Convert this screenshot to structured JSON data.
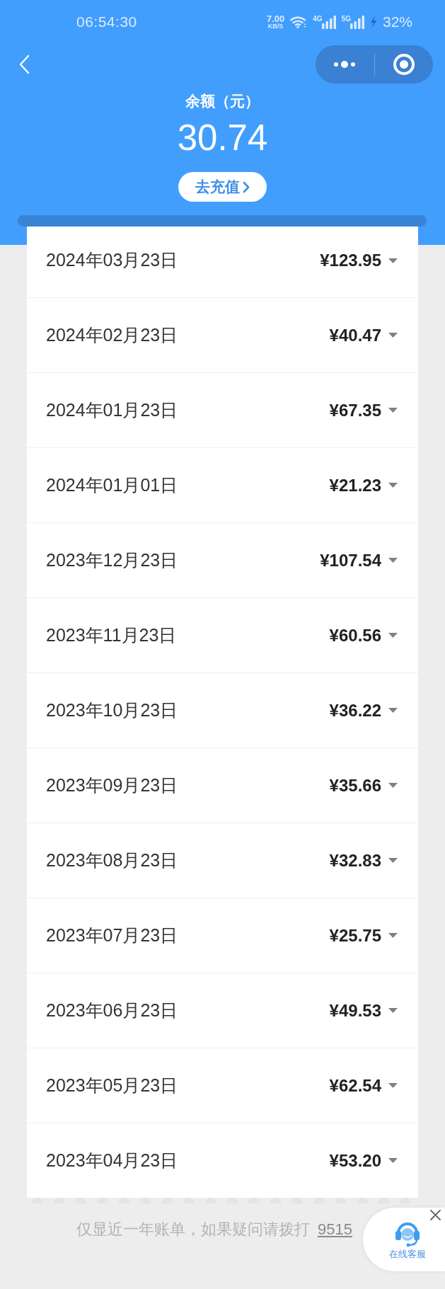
{
  "status_bar": {
    "time": "06:54:30",
    "network_speed": "7.00",
    "network_speed_unit": "KB/S",
    "signal_labels": [
      "4G",
      "5G"
    ],
    "battery": "32%"
  },
  "header": {
    "balance_label": "余额（元）",
    "balance": "30.74",
    "recharge_button": "去充值"
  },
  "bills": [
    {
      "date": "2024年03月23日",
      "amount": "¥123.95",
      "expanded": false
    },
    {
      "date": "2024年02月23日",
      "amount": "¥40.47",
      "expanded": false
    },
    {
      "date": "2024年01月23日",
      "amount": "¥67.35",
      "expanded": false
    },
    {
      "date": "2024年01月01日",
      "amount": "¥21.23",
      "expanded": false
    },
    {
      "date": "2023年12月23日",
      "amount": "¥107.54",
      "expanded": false
    },
    {
      "date": "2023年11月23日",
      "amount": "¥60.56",
      "expanded": false
    },
    {
      "date": "2023年10月23日",
      "amount": "¥36.22",
      "expanded": false
    },
    {
      "date": "2023年09月23日",
      "amount": "¥35.66",
      "expanded": false
    },
    {
      "date": "2023年08月23日",
      "amount": "¥32.83",
      "expanded": false
    },
    {
      "date": "2023年07月23日",
      "amount": "¥25.75",
      "expanded": false
    },
    {
      "date": "2023年06月23日",
      "amount": "¥49.53",
      "expanded": false
    },
    {
      "date": "2023年05月23日",
      "amount": "¥62.54",
      "expanded": false
    },
    {
      "date": "2023年04月23日",
      "amount": "¥53.20",
      "expanded": false
    }
  ],
  "footer": {
    "note": "仅显近一年账单，如果疑问请拨打",
    "phone": "9515"
  },
  "service_bubble": {
    "label": "在线客服"
  }
}
